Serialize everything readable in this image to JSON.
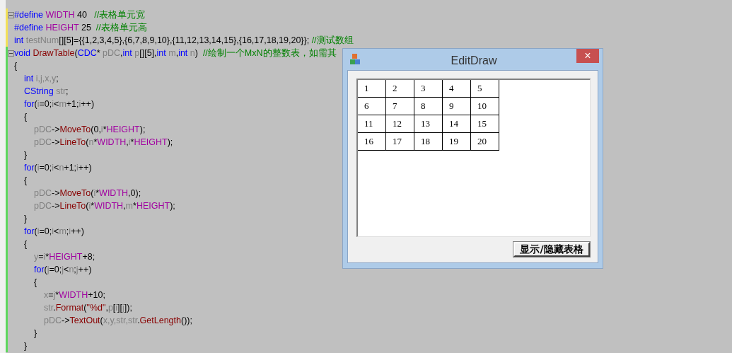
{
  "editor": {
    "lines": [
      {
        "color": "#f2e05a",
        "fold": true,
        "tokens": [
          {
            "kind": "kw",
            "t": "#define "
          },
          {
            "kind": "mac",
            "t": "WIDTH"
          },
          {
            "kind": "p",
            "t": " 40   "
          },
          {
            "kind": "cm",
            "t": "//表格单元宽"
          }
        ]
      },
      {
        "color": "#f2e05a",
        "fold": false,
        "tokens": [
          {
            "kind": "kw",
            "t": "#define "
          },
          {
            "kind": "mac",
            "t": "HEIGHT"
          },
          {
            "kind": "p",
            "t": " 25  "
          },
          {
            "kind": "cm",
            "t": "//表格单元高"
          }
        ]
      },
      {
        "color": "#f2e05a",
        "fold": false,
        "tokens": [
          {
            "kind": "kw",
            "t": "int "
          },
          {
            "kind": "var",
            "t": "testNum"
          },
          {
            "kind": "p",
            "t": "[][5]={{1,2,3,4,5},{6,7,8,9,10},{11,12,13,14,15},{16,17,18,19,20}}; "
          },
          {
            "kind": "cm",
            "t": "//测试数组"
          }
        ]
      },
      {
        "color": "#5ed65e",
        "fold": true,
        "tokens": [
          {
            "kind": "kw",
            "t": "void "
          },
          {
            "kind": "fn",
            "t": "DrawTable"
          },
          {
            "kind": "p",
            "t": "("
          },
          {
            "kind": "kw",
            "t": "CDC"
          },
          {
            "kind": "p",
            "t": "* "
          },
          {
            "kind": "var",
            "t": "pDC"
          },
          {
            "kind": "p",
            "t": ","
          },
          {
            "kind": "kw",
            "t": "int "
          },
          {
            "kind": "var",
            "t": "p"
          },
          {
            "kind": "p",
            "t": "[][5],"
          },
          {
            "kind": "kw",
            "t": "int "
          },
          {
            "kind": "var",
            "t": "m"
          },
          {
            "kind": "p",
            "t": ","
          },
          {
            "kind": "kw",
            "t": "int "
          },
          {
            "kind": "var",
            "t": "n"
          },
          {
            "kind": "p",
            "t": ")  "
          },
          {
            "kind": "cm",
            "t": "//绘制一个MxN的整数表，如需其"
          }
        ]
      },
      {
        "color": "#5ed65e",
        "fold": false,
        "tokens": [
          {
            "kind": "p",
            "t": "{"
          }
        ]
      },
      {
        "color": "#5ed65e",
        "fold": false,
        "tokens": [
          {
            "kind": "kw",
            "t": "\tint "
          },
          {
            "kind": "var",
            "t": "i,j,x,y"
          },
          {
            "kind": "p",
            "t": ";"
          }
        ]
      },
      {
        "color": "#5ed65e",
        "fold": false,
        "tokens": [
          {
            "kind": "kw",
            "t": "\tCString "
          },
          {
            "kind": "var",
            "t": "str"
          },
          {
            "kind": "p",
            "t": ";"
          }
        ]
      },
      {
        "color": "#5ed65e",
        "fold": false,
        "tokens": [
          {
            "kind": "kw",
            "t": "\tfor"
          },
          {
            "kind": "p",
            "t": "("
          },
          {
            "kind": "var",
            "t": "i"
          },
          {
            "kind": "p",
            "t": "=0;"
          },
          {
            "kind": "var",
            "t": "i"
          },
          {
            "kind": "p",
            "t": "<"
          },
          {
            "kind": "var",
            "t": "m"
          },
          {
            "kind": "p",
            "t": "+1;"
          },
          {
            "kind": "var",
            "t": "i"
          },
          {
            "kind": "p",
            "t": "++)"
          }
        ]
      },
      {
        "color": "#5ed65e",
        "fold": false,
        "tokens": [
          {
            "kind": "p",
            "t": "\t{"
          }
        ]
      },
      {
        "color": "#5ed65e",
        "fold": false,
        "tokens": [
          {
            "kind": "var",
            "t": "\t\tpDC"
          },
          {
            "kind": "p",
            "t": "->"
          },
          {
            "kind": "fn",
            "t": "MoveTo"
          },
          {
            "kind": "p",
            "t": "(0,"
          },
          {
            "kind": "var",
            "t": "i"
          },
          {
            "kind": "p",
            "t": "*"
          },
          {
            "kind": "mac",
            "t": "HEIGHT"
          },
          {
            "kind": "p",
            "t": ");"
          }
        ]
      },
      {
        "color": "#5ed65e",
        "fold": false,
        "tokens": [
          {
            "kind": "var",
            "t": "\t\tpDC"
          },
          {
            "kind": "p",
            "t": "->"
          },
          {
            "kind": "fn",
            "t": "LineTo"
          },
          {
            "kind": "p",
            "t": "("
          },
          {
            "kind": "var",
            "t": "n"
          },
          {
            "kind": "p",
            "t": "*"
          },
          {
            "kind": "mac",
            "t": "WIDTH"
          },
          {
            "kind": "p",
            "t": ","
          },
          {
            "kind": "var",
            "t": "i"
          },
          {
            "kind": "p",
            "t": "*"
          },
          {
            "kind": "mac",
            "t": "HEIGHT"
          },
          {
            "kind": "p",
            "t": ");"
          }
        ]
      },
      {
        "color": "#5ed65e",
        "fold": false,
        "tokens": [
          {
            "kind": "p",
            "t": "\t}"
          }
        ]
      },
      {
        "color": "#5ed65e",
        "fold": false,
        "tokens": [
          {
            "kind": "kw",
            "t": "\tfor"
          },
          {
            "kind": "p",
            "t": "("
          },
          {
            "kind": "var",
            "t": "i"
          },
          {
            "kind": "p",
            "t": "=0;"
          },
          {
            "kind": "var",
            "t": "i"
          },
          {
            "kind": "p",
            "t": "<"
          },
          {
            "kind": "var",
            "t": "n"
          },
          {
            "kind": "p",
            "t": "+1;"
          },
          {
            "kind": "var",
            "t": "i"
          },
          {
            "kind": "p",
            "t": "++)"
          }
        ]
      },
      {
        "color": "#5ed65e",
        "fold": false,
        "tokens": [
          {
            "kind": "p",
            "t": "\t{"
          }
        ]
      },
      {
        "color": "#5ed65e",
        "fold": false,
        "tokens": [
          {
            "kind": "var",
            "t": "\t\tpDC"
          },
          {
            "kind": "p",
            "t": "->"
          },
          {
            "kind": "fn",
            "t": "MoveTo"
          },
          {
            "kind": "p",
            "t": "("
          },
          {
            "kind": "var",
            "t": "i"
          },
          {
            "kind": "p",
            "t": "*"
          },
          {
            "kind": "mac",
            "t": "WIDTH"
          },
          {
            "kind": "p",
            "t": ",0);"
          }
        ]
      },
      {
        "color": "#5ed65e",
        "fold": false,
        "tokens": [
          {
            "kind": "var",
            "t": "\t\tpDC"
          },
          {
            "kind": "p",
            "t": "->"
          },
          {
            "kind": "fn",
            "t": "LineTo"
          },
          {
            "kind": "p",
            "t": "("
          },
          {
            "kind": "var",
            "t": "i"
          },
          {
            "kind": "p",
            "t": "*"
          },
          {
            "kind": "mac",
            "t": "WIDTH"
          },
          {
            "kind": "p",
            "t": ","
          },
          {
            "kind": "var",
            "t": "m"
          },
          {
            "kind": "p",
            "t": "*"
          },
          {
            "kind": "mac",
            "t": "HEIGHT"
          },
          {
            "kind": "p",
            "t": ");"
          }
        ]
      },
      {
        "color": "#5ed65e",
        "fold": false,
        "tokens": [
          {
            "kind": "p",
            "t": "\t}"
          }
        ]
      },
      {
        "color": "#5ed65e",
        "fold": false,
        "tokens": [
          {
            "kind": "kw",
            "t": "\tfor"
          },
          {
            "kind": "p",
            "t": "("
          },
          {
            "kind": "var",
            "t": "i"
          },
          {
            "kind": "p",
            "t": "=0;"
          },
          {
            "kind": "var",
            "t": "i"
          },
          {
            "kind": "p",
            "t": "<"
          },
          {
            "kind": "var",
            "t": "m"
          },
          {
            "kind": "p",
            "t": ";"
          },
          {
            "kind": "var",
            "t": "i"
          },
          {
            "kind": "p",
            "t": "++)"
          }
        ]
      },
      {
        "color": "#5ed65e",
        "fold": false,
        "tokens": [
          {
            "kind": "p",
            "t": "\t{"
          }
        ]
      },
      {
        "color": "#5ed65e",
        "fold": false,
        "tokens": [
          {
            "kind": "var",
            "t": "\t\ty"
          },
          {
            "kind": "p",
            "t": "="
          },
          {
            "kind": "var",
            "t": "i"
          },
          {
            "kind": "p",
            "t": "*"
          },
          {
            "kind": "mac",
            "t": "HEIGHT"
          },
          {
            "kind": "p",
            "t": "+8;"
          }
        ]
      },
      {
        "color": "#5ed65e",
        "fold": false,
        "tokens": [
          {
            "kind": "kw",
            "t": "\t\tfor"
          },
          {
            "kind": "p",
            "t": "("
          },
          {
            "kind": "var",
            "t": "j"
          },
          {
            "kind": "p",
            "t": "=0;"
          },
          {
            "kind": "var",
            "t": "j"
          },
          {
            "kind": "p",
            "t": "<"
          },
          {
            "kind": "var",
            "t": "n"
          },
          {
            "kind": "p",
            "t": ";"
          },
          {
            "kind": "var",
            "t": "j"
          },
          {
            "kind": "p",
            "t": "++)"
          }
        ]
      },
      {
        "color": "#5ed65e",
        "fold": false,
        "tokens": [
          {
            "kind": "p",
            "t": "\t\t{"
          }
        ]
      },
      {
        "color": "#5ed65e",
        "fold": false,
        "tokens": [
          {
            "kind": "var",
            "t": "\t\t\tx"
          },
          {
            "kind": "p",
            "t": "="
          },
          {
            "kind": "var",
            "t": "j"
          },
          {
            "kind": "p",
            "t": "*"
          },
          {
            "kind": "mac",
            "t": "WIDTH"
          },
          {
            "kind": "p",
            "t": "+10;"
          }
        ]
      },
      {
        "color": "#5ed65e",
        "fold": false,
        "tokens": [
          {
            "kind": "var",
            "t": "\t\t\tstr"
          },
          {
            "kind": "p",
            "t": "."
          },
          {
            "kind": "fn",
            "t": "Format"
          },
          {
            "kind": "p",
            "t": "("
          },
          {
            "kind": "fn",
            "t": "\"%d\""
          },
          {
            "kind": "p",
            "t": ","
          },
          {
            "kind": "var",
            "t": "p"
          },
          {
            "kind": "p",
            "t": "["
          },
          {
            "kind": "var",
            "t": "i"
          },
          {
            "kind": "p",
            "t": "]["
          },
          {
            "kind": "var",
            "t": "j"
          },
          {
            "kind": "p",
            "t": "]);"
          }
        ]
      },
      {
        "color": "#5ed65e",
        "fold": false,
        "tokens": [
          {
            "kind": "var",
            "t": "\t\t\tpDC"
          },
          {
            "kind": "p",
            "t": "->"
          },
          {
            "kind": "fn",
            "t": "TextOut"
          },
          {
            "kind": "p",
            "t": "("
          },
          {
            "kind": "var",
            "t": "x,y,str,str"
          },
          {
            "kind": "p",
            "t": "."
          },
          {
            "kind": "fn",
            "t": "GetLength"
          },
          {
            "kind": "p",
            "t": "());"
          }
        ]
      },
      {
        "color": "#5ed65e",
        "fold": false,
        "tokens": [
          {
            "kind": "p",
            "t": "\t\t}"
          }
        ]
      },
      {
        "color": "#5ed65e",
        "fold": false,
        "tokens": [
          {
            "kind": "p",
            "t": "\t}"
          }
        ]
      }
    ]
  },
  "dialog": {
    "title": "EditDraw",
    "close": "×",
    "table": {
      "rows": [
        [
          "1",
          "2",
          "3",
          "4",
          "5"
        ],
        [
          "6",
          "7",
          "8",
          "9",
          "10"
        ],
        [
          "11",
          "12",
          "13",
          "14",
          "15"
        ],
        [
          "16",
          "17",
          "18",
          "19",
          "20"
        ]
      ]
    },
    "button": "显示/隐藏表格"
  }
}
